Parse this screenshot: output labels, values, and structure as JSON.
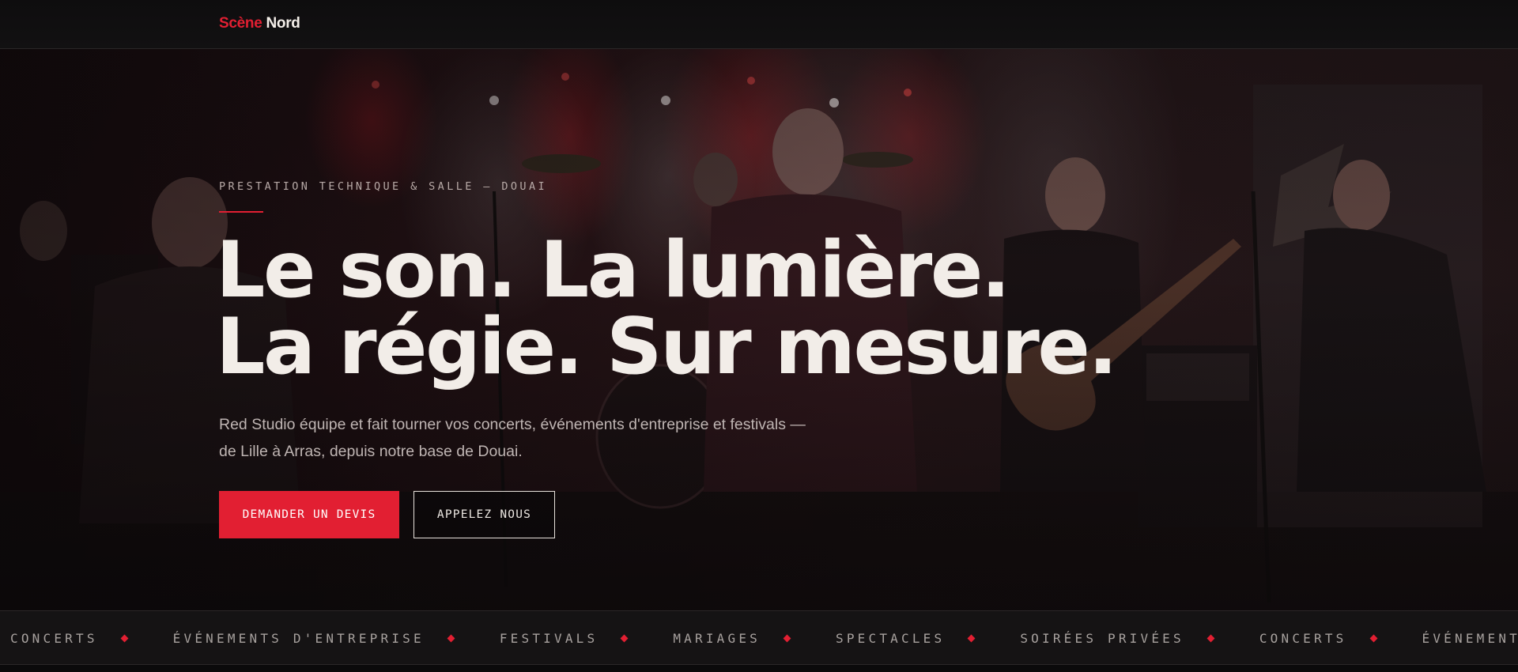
{
  "header": {
    "logo_part1": "Scène",
    "logo_part2": "Nord"
  },
  "hero": {
    "eyebrow": "PRESTATION TECHNIQUE & SALLE — DOUAI",
    "headline_line1": "Le son. La lumière.",
    "headline_line2": "La régie. Sur mesure.",
    "subtitle": "Red Studio équipe et fait tourner vos concerts, événements d'entreprise et festivals — de Lille à Arras, depuis notre base de Douai.",
    "primary_button": "DEMANDER UN DEVIS",
    "secondary_button": "APPELEZ NOUS"
  },
  "ticker": {
    "items": [
      "CONCERTS",
      "ÉVÉNEMENTS D'ENTREPRISE",
      "FESTIVALS",
      "MARIAGES",
      "SPECTACLES",
      "SOIRÉES PRIVÉES",
      "CONCERTS",
      "ÉVÉNEMENTS D'ENTREPRISE"
    ]
  },
  "colors": {
    "accent": "#e21f32",
    "background": "#0b0a0b",
    "text": "#f2ede8"
  }
}
